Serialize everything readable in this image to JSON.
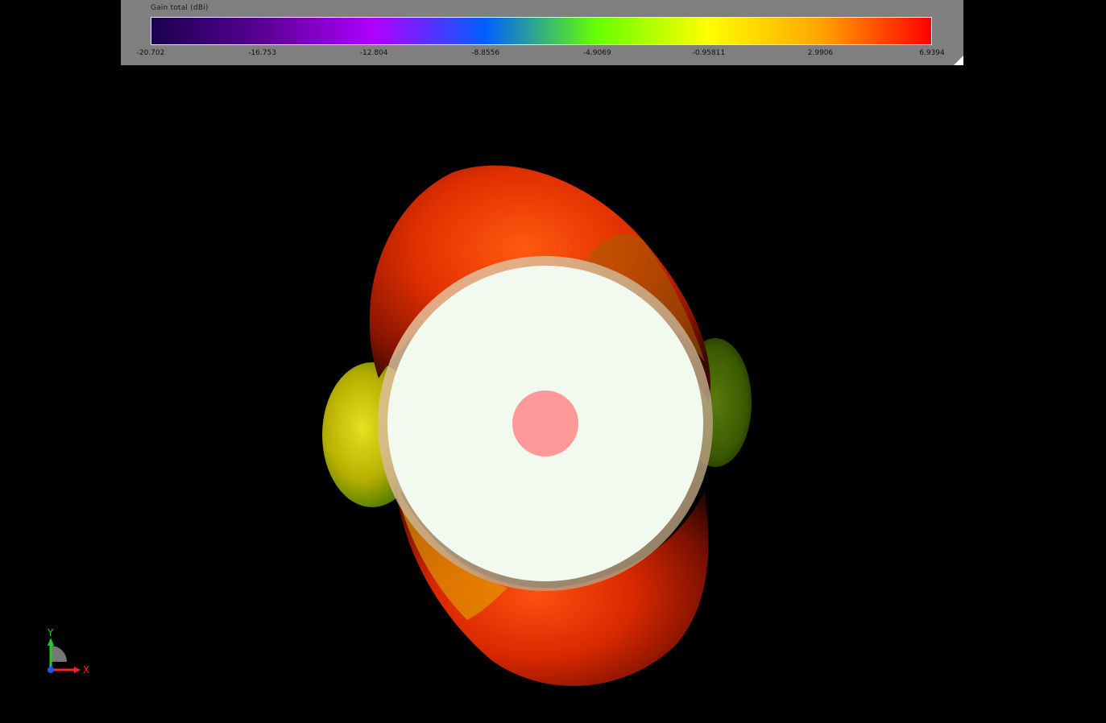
{
  "legend": {
    "title": "Gain total (dBi)",
    "ticks": [
      {
        "label": "-20.702",
        "value": -20.702
      },
      {
        "label": "-16.753",
        "value": -16.753
      },
      {
        "label": "-12.804",
        "value": -12.804
      },
      {
        "label": "-8.8556",
        "value": -8.8556
      },
      {
        "label": "-4.9069",
        "value": -4.9069
      },
      {
        "label": "-0.95811",
        "value": -0.95811
      },
      {
        "label": "2.9906",
        "value": 2.9906
      },
      {
        "label": "6.9394",
        "value": 6.9394
      }
    ],
    "min": -20.702,
    "max": 6.9394,
    "colors": [
      "#1a0050",
      "#5a0094",
      "#b000ff",
      "#0060ff",
      "#66ff00",
      "#ffff00",
      "#ffa500",
      "#ff0000"
    ]
  },
  "triad": {
    "y_label": "Y",
    "x_label": "X",
    "y_color": "#22cc22",
    "x_color": "#ff2222",
    "z_color": "#2255ff"
  },
  "scene": {
    "background": "#000000",
    "disc_color": "#f2faf0",
    "feed_color": "#ff9999"
  }
}
